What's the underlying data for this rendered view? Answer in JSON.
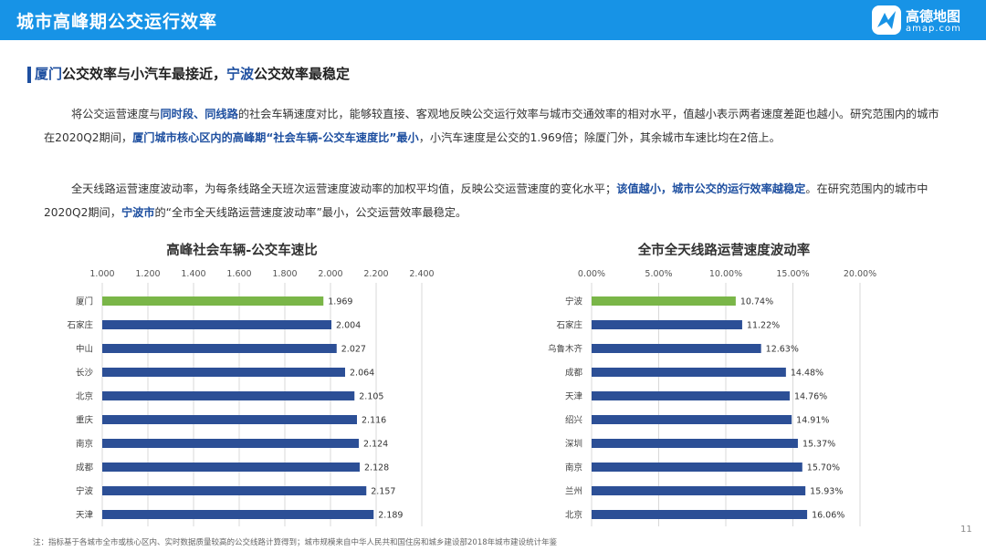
{
  "header": {
    "title": "城市高峰期公交运行效率",
    "logo_cn": "高德地图",
    "logo_en": "amap.com"
  },
  "headline": {
    "part1": "厦门",
    "part2": "公交效率与小汽车最接近，",
    "part3": "宁波",
    "part4": "公交效率最稳定"
  },
  "paragraphs": {
    "p1_a": "将公交运营速度与",
    "p1_b": "同时段、同线路",
    "p1_c": "的社会车辆速度对比，能够较直接、客观地反映公交运行效率与城市交通效率的相对水平，值越小表示两者速度差距也越小。研究范围内的城市在2020Q2期间，",
    "p1_d": "厦门城市核心区内的高峰期“社会车辆-公交车速度比”最小",
    "p1_e": "，小汽车速度是公交的1.969倍；除厦门外，其余城市车速比均在2倍上。",
    "p2_a": "全天线路运营速度波动率，为每条线路全天班次运营速度波动率的加权平均值，反映公交运营速度的变化水平；",
    "p2_b": "该值越小，城市公交的运行效率越稳定",
    "p2_c": "。在研究范围内的城市中2020Q2期间，",
    "p2_d": "宁波市",
    "p2_e": "的“全市全天线路运营速度波动率”最小，公交运营效率最稳定。"
  },
  "colors": {
    "header_bg": "#1793e6",
    "accent": "#1e4fa0",
    "bar": "#2c4f96",
    "bar_highlight": "#7ab648"
  },
  "chart_data": [
    {
      "type": "bar",
      "orientation": "horizontal",
      "title": "高峰社会车辆-公交车速比",
      "categories": [
        "厦门",
        "石家庄",
        "中山",
        "长沙",
        "北京",
        "重庆",
        "南京",
        "成都",
        "宁波",
        "天津"
      ],
      "values": [
        1.969,
        2.004,
        2.027,
        2.064,
        2.105,
        2.116,
        2.124,
        2.128,
        2.157,
        2.189
      ],
      "value_labels": [
        "1.969",
        "2.004",
        "2.027",
        "2.064",
        "2.105",
        "2.116",
        "2.124",
        "2.128",
        "2.157",
        "2.189"
      ],
      "highlight_index": 0,
      "xlim": [
        1.0,
        2.4
      ],
      "ticks": [
        1.0,
        1.2,
        1.4,
        1.6,
        1.8,
        2.0,
        2.2,
        2.4
      ],
      "tick_labels": [
        "1.000",
        "1.200",
        "1.400",
        "1.600",
        "1.800",
        "2.000",
        "2.200",
        "2.400"
      ],
      "axis_position": "top",
      "grid": true
    },
    {
      "type": "bar",
      "orientation": "horizontal",
      "title": "全市全天线路运营速度波动率",
      "categories": [
        "宁波",
        "石家庄",
        "乌鲁木齐",
        "成都",
        "天津",
        "绍兴",
        "深圳",
        "南京",
        "兰州",
        "北京"
      ],
      "values": [
        10.74,
        11.22,
        12.63,
        14.48,
        14.76,
        14.91,
        15.37,
        15.7,
        15.93,
        16.06
      ],
      "value_labels": [
        "10.74%",
        "11.22%",
        "12.63%",
        "14.48%",
        "14.76%",
        "14.91%",
        "15.37%",
        "15.70%",
        "15.93%",
        "16.06%"
      ],
      "highlight_index": 0,
      "xlim": [
        0,
        20
      ],
      "ticks": [
        0,
        5,
        10,
        15,
        20
      ],
      "tick_labels": [
        "0.00%",
        "5.00%",
        "10.00%",
        "15.00%",
        "20.00%"
      ],
      "axis_position": "top",
      "grid": true
    }
  ],
  "footnote": "注：指标基于各城市全市或核心区内、实时数据质量较高的公交线路计算得到；城市规模来自中华人民共和国住房和城乡建设部2018年城市建设统计年鉴",
  "page_number": "11"
}
